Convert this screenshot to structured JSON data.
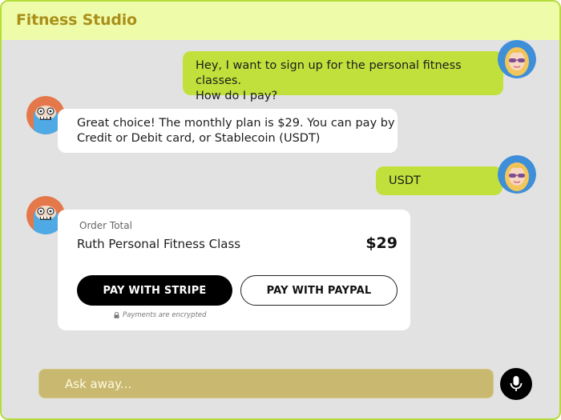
{
  "header": {
    "title": "Fitness Studio"
  },
  "messages": [
    {
      "role": "user",
      "text_line1": "Hey, I want to sign up for the personal fitness classes.",
      "text_line2": "How do I pay?"
    },
    {
      "role": "bot",
      "text_line1": "Great choice! The monthly plan is $29. You can pay by",
      "text_line2": "Credit or Debit card, or Stablecoin (USDT)"
    },
    {
      "role": "user",
      "text_line1": "USDT"
    }
  ],
  "order": {
    "label": "Order Total",
    "product": "Ruth Personal Fitness Class",
    "price": "$29",
    "stripe_button": "PAY WITH STRIPE",
    "paypal_button": "PAY WITH PAYPAL",
    "secure_note": "Payments are encrypted"
  },
  "composer": {
    "placeholder": "Ask away..."
  },
  "colors": {
    "frame_border": "#b6dc3c",
    "header_bg": "#eefcaa",
    "title": "#aa8f19",
    "user_bubble": "#c1e03b",
    "input_bg": "#c8b870"
  },
  "icons": [
    "user-avatar",
    "assistant-avatar",
    "lock-icon",
    "mic-icon"
  ]
}
